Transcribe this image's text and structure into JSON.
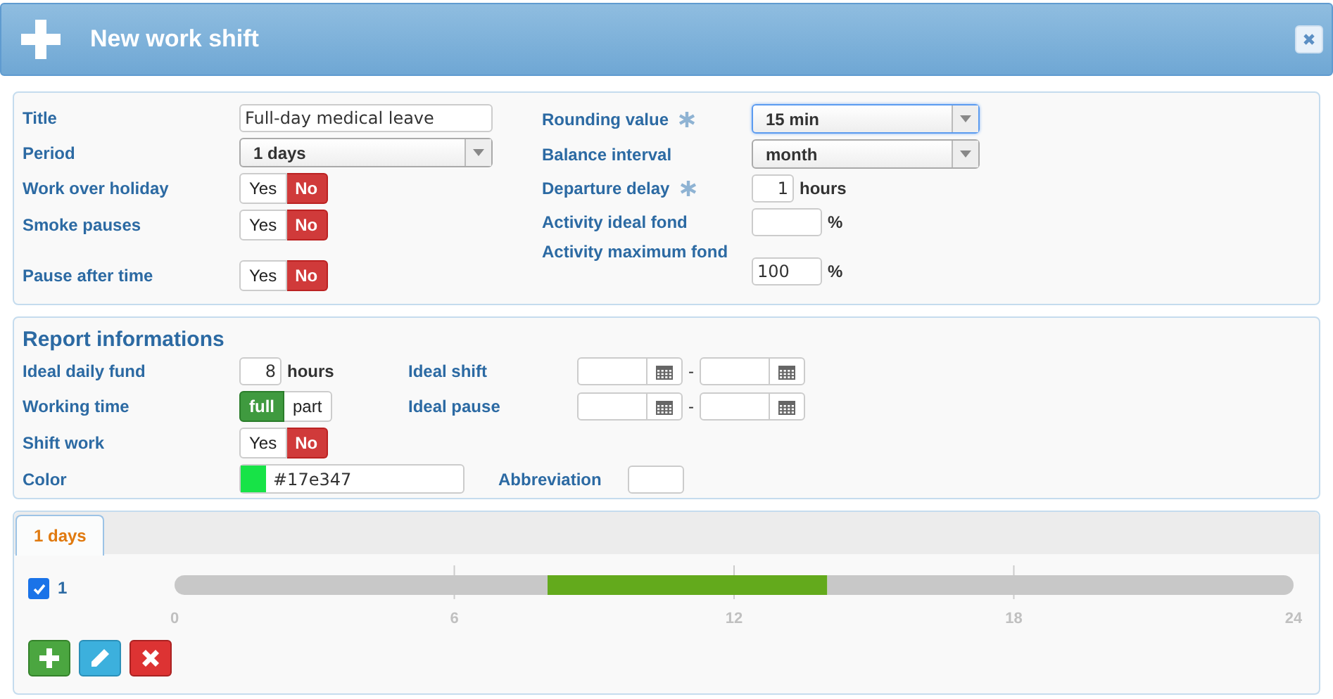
{
  "window": {
    "title": "New work shift"
  },
  "general": {
    "left": [
      {
        "kind": "text",
        "label": "Title",
        "value": "Full-day medical leave"
      },
      {
        "kind": "select",
        "label": "Period",
        "value": "1 days"
      },
      {
        "kind": "toggle",
        "label": "Work over holiday",
        "options": [
          {
            "label": "Yes",
            "selected": false
          },
          {
            "label": "No",
            "selected": true
          }
        ]
      },
      {
        "kind": "toggle",
        "label": "Smoke pauses",
        "options": [
          {
            "label": "Yes",
            "selected": false
          },
          {
            "label": "No",
            "selected": true
          }
        ]
      },
      {
        "kind": "toggle",
        "label": "Pause after time",
        "options": [
          {
            "label": "Yes",
            "selected": false
          },
          {
            "label": "No",
            "selected": true
          }
        ]
      }
    ],
    "right": [
      {
        "kind": "select",
        "label": "Rounding value",
        "required": true,
        "focused": true,
        "value": "15 min"
      },
      {
        "kind": "select",
        "label": "Balance interval",
        "required": false,
        "focused": false,
        "value": "month"
      },
      {
        "kind": "number",
        "label": "Departure delay",
        "required": true,
        "value": "1",
        "unit": "hours"
      },
      {
        "kind": "number",
        "label": "Activity ideal fond",
        "required": false,
        "unit": "%"
      },
      {
        "kind": "number",
        "label": "Activity maximum fond",
        "required": false,
        "value": "100",
        "unit": "%"
      }
    ]
  },
  "report": {
    "heading": "Report informations",
    "ideal_daily_fund": {
      "label": "Ideal daily fund",
      "value": "8",
      "unit": "hours"
    },
    "working_time": {
      "label": "Working time",
      "options": [
        {
          "label": "full",
          "selected": true
        },
        {
          "label": "part",
          "selected": false
        }
      ]
    },
    "shift_work": {
      "label": "Shift work",
      "options": [
        {
          "label": "Yes",
          "selected": false
        },
        {
          "label": "No",
          "selected": true
        }
      ]
    },
    "color": {
      "label": "Color",
      "value": "#17e347",
      "color": "#17e347"
    },
    "ideal_shift": {
      "label": "Ideal shift",
      "separator": "-"
    },
    "ideal_pause": {
      "label": "Ideal pause",
      "separator": "-"
    },
    "abbreviation": {
      "label": "Abbreviation"
    }
  },
  "tabs": [
    {
      "label": "1 days",
      "selected": true
    }
  ],
  "days": [
    {
      "label": "1",
      "checked": true
    }
  ],
  "chart_data": {
    "type": "bar",
    "orientation": "horizontal",
    "stacked": true,
    "grid": true,
    "xlim": [
      0,
      24
    ],
    "xticks": [
      0,
      6,
      12,
      18,
      24
    ],
    "series": [
      {
        "color": "#c8c8c8",
        "values": [
          8
        ]
      },
      {
        "color": "#63aa1c",
        "values": [
          6
        ]
      },
      {
        "color": "#c8c8c8",
        "values": [
          10
        ]
      }
    ]
  },
  "actions": [
    {
      "kind": "add"
    },
    {
      "kind": "edit"
    },
    {
      "kind": "delete"
    }
  ]
}
